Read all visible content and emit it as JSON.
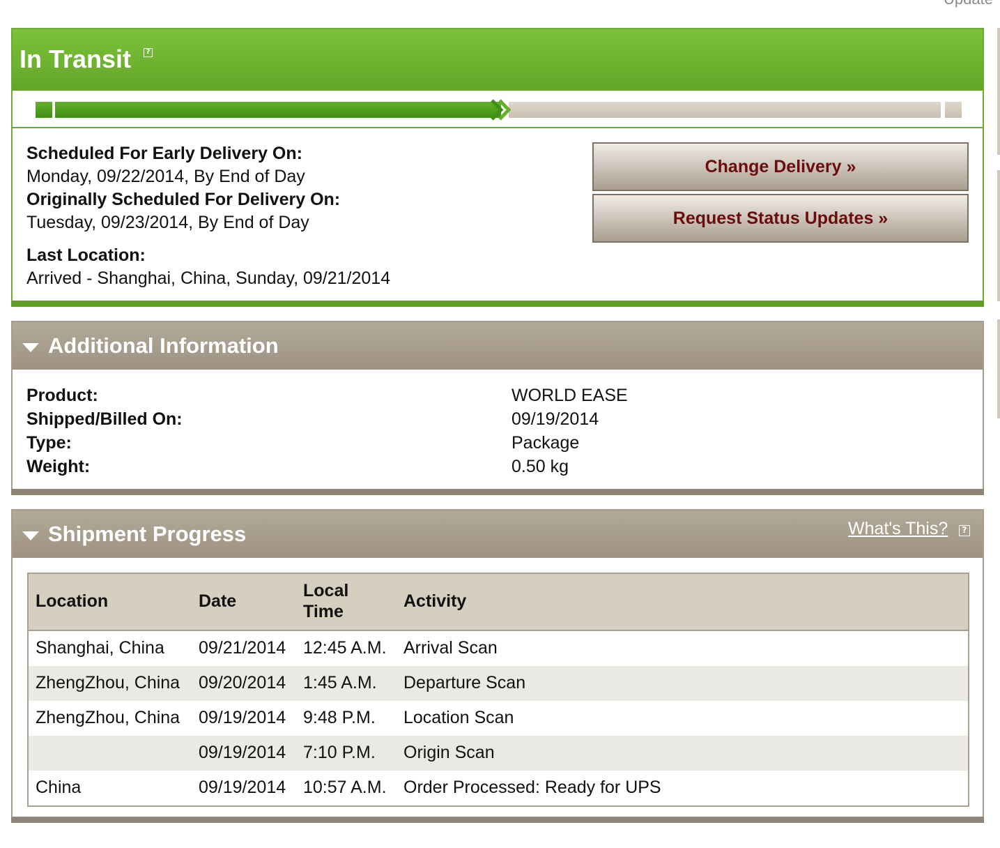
{
  "corner_text": "Update",
  "transit": {
    "title": "In Transit",
    "help_icon": "?",
    "progress": 0.5,
    "early_label": "Scheduled For Early Delivery On:",
    "early_value": "Monday, 09/22/2014, By End of Day",
    "orig_label": "Originally Scheduled For Delivery On:",
    "orig_value": "Tuesday, 09/23/2014, By End of Day",
    "last_label": "Last Location:",
    "last_value": "Arrived - Shanghai, China, Sunday, 09/21/2014",
    "change_delivery": "Change Delivery »",
    "request_updates": "Request Status Updates »"
  },
  "additional": {
    "title": "Additional Information",
    "rows": [
      {
        "label": "Product:",
        "value": "WORLD EASE"
      },
      {
        "label": "Shipped/Billed On:",
        "value": "09/19/2014"
      },
      {
        "label": "Type:",
        "value": "Package"
      },
      {
        "label": "Weight:",
        "value": "0.50 kg"
      }
    ]
  },
  "shipment": {
    "title": "Shipment Progress",
    "whats_this": "What's This?",
    "help_icon": "?",
    "columns": [
      "Location",
      "Date",
      "Local Time",
      "Activity"
    ],
    "rows": [
      {
        "location": "Shanghai, China",
        "date": "09/21/2014",
        "time": "12:45 A.M.",
        "activity": "Arrival Scan"
      },
      {
        "location": "ZhengZhou, China",
        "date": "09/20/2014",
        "time": "1:45 A.M.",
        "activity": "Departure Scan"
      },
      {
        "location": "ZhengZhou, China",
        "date": "09/19/2014",
        "time": "9:48 P.M.",
        "activity": "Location Scan"
      },
      {
        "location": "",
        "date": "09/19/2014",
        "time": "7:10 P.M.",
        "activity": "Origin Scan"
      },
      {
        "location": "China",
        "date": "09/19/2014",
        "time": "10:57 A.M.",
        "activity": "Order Processed: Ready for UPS"
      }
    ]
  },
  "colors": {
    "transit_green": "#7cc23b",
    "panel_tan": "#a99f8f",
    "button_text": "#6a0d0d",
    "row_alt": "#ebe9e3"
  }
}
